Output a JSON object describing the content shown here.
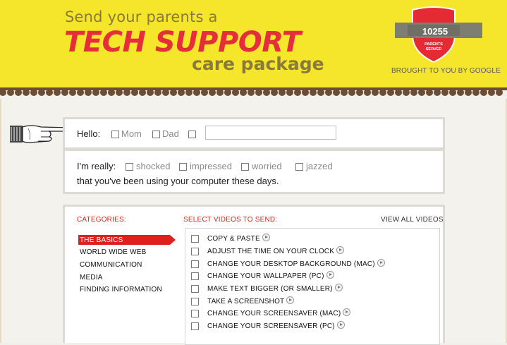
{
  "header": {
    "line1": "Send your parents a",
    "line2": "TECH SUPPORT",
    "line3": "care package",
    "counter": "10255",
    "counter_caption_1": "PARENTS",
    "counter_caption_2": "SERVED",
    "brought_by": "BROUGHT TO YOU BY GOOGLE"
  },
  "hello": {
    "label": "Hello:",
    "options": [
      "Mom",
      "Dad",
      ""
    ],
    "name_value": ""
  },
  "really": {
    "label": "I'm really:",
    "options": [
      "shocked",
      "impressed",
      "worried",
      "jazzed"
    ],
    "sentence": "that you've been using your computer these days."
  },
  "categories": {
    "title": "CATEGORIES:",
    "items": [
      "THE BASICS",
      "WORLD WIDE WEB",
      "COMMUNICATION",
      "MEDIA",
      "FINDING INFORMATION"
    ],
    "active": "THE BASICS"
  },
  "videos": {
    "title": "SELECT VIDEOS TO SEND:",
    "view_all": "VIEW ALL VIDEOS",
    "items": [
      "COPY & PASTE",
      "ADJUST THE TIME ON YOUR CLOCK",
      "CHANGE YOUR DESKTOP BACKGROUND (MAC)",
      "CHANGE YOUR WALLPAPER (PC)",
      "MAKE TEXT BIGGER (OR SMALLER)",
      "TAKE A SCREENSHOT",
      "CHANGE YOUR SCREENSAVER (MAC)",
      "CHANGE YOUR SCREENSAVER (PC)"
    ]
  },
  "colors": {
    "header_yellow": "#f5e52b",
    "title_red": "#e52d3c",
    "subtitle_olive": "#8a7a3a",
    "active_red": "#e0201c"
  }
}
